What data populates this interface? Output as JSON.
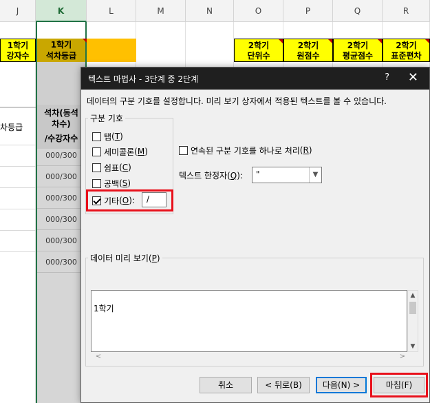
{
  "spreadsheet": {
    "columns": [
      "J",
      "K",
      "L",
      "M",
      "N",
      "O",
      "P",
      "Q",
      "R"
    ],
    "selected_column": "K",
    "headers": {
      "j_line1": "1학기",
      "j_line2": "강자수",
      "k_line1": "1학기",
      "k_line2": "석차등급",
      "o_line1": "2학기",
      "o_line2": "단위수",
      "p_line1": "2학기",
      "p_line2": "원점수",
      "q_line1": "2학기",
      "q_line2": "평균점수",
      "r_line1": "2학기",
      "r_line2": "표준편차"
    },
    "j_subheader": "차등급",
    "k_subheader_line1": "석차(동석",
    "k_subheader_line2": "차수)",
    "k_subheader_line3": "/수강자수",
    "k_values": [
      "000/300",
      "000/300",
      "000/300",
      "000/300",
      "000/300",
      "000/300"
    ]
  },
  "dialog": {
    "title": "텍스트 마법사 - 3단계 중 2단계",
    "help_label": "?",
    "close_label": "✕",
    "description": "데이터의 구분 기호를 설정합니다. 미리 보기 상자에서 적용된 텍스트를 볼 수 있습니다.",
    "delimiters_title": "구분 기호",
    "delimiters": [
      {
        "label": "탭",
        "key": "T",
        "checked": false
      },
      {
        "label": "세미콜론",
        "key": "M",
        "checked": false
      },
      {
        "label": "쉼표",
        "key": "C",
        "checked": false
      },
      {
        "label": "공백",
        "key": "S",
        "checked": false
      },
      {
        "label": "기타",
        "key": "O",
        "checked": true
      }
    ],
    "other_value": "/",
    "consecutive_label": "연속된 구분 기호를 하나로 처리",
    "consecutive_key": "R",
    "consecutive_checked": false,
    "qualifier_label": "텍스트 한정자",
    "qualifier_key": "Q",
    "qualifier_value": "\"",
    "preview_title": "데이터 미리 보기",
    "preview_key": "P",
    "preview_lines": [
      "1학기"
    ],
    "buttons": {
      "cancel": "취소",
      "back": "< 뒤로(B)",
      "next": "다음(N) >",
      "finish": "마침(F)"
    }
  },
  "colors": {
    "excel_green": "#217346",
    "highlight_red": "#e8101b",
    "header_yellow": "#ffff00",
    "header_orange": "#ffc000"
  }
}
